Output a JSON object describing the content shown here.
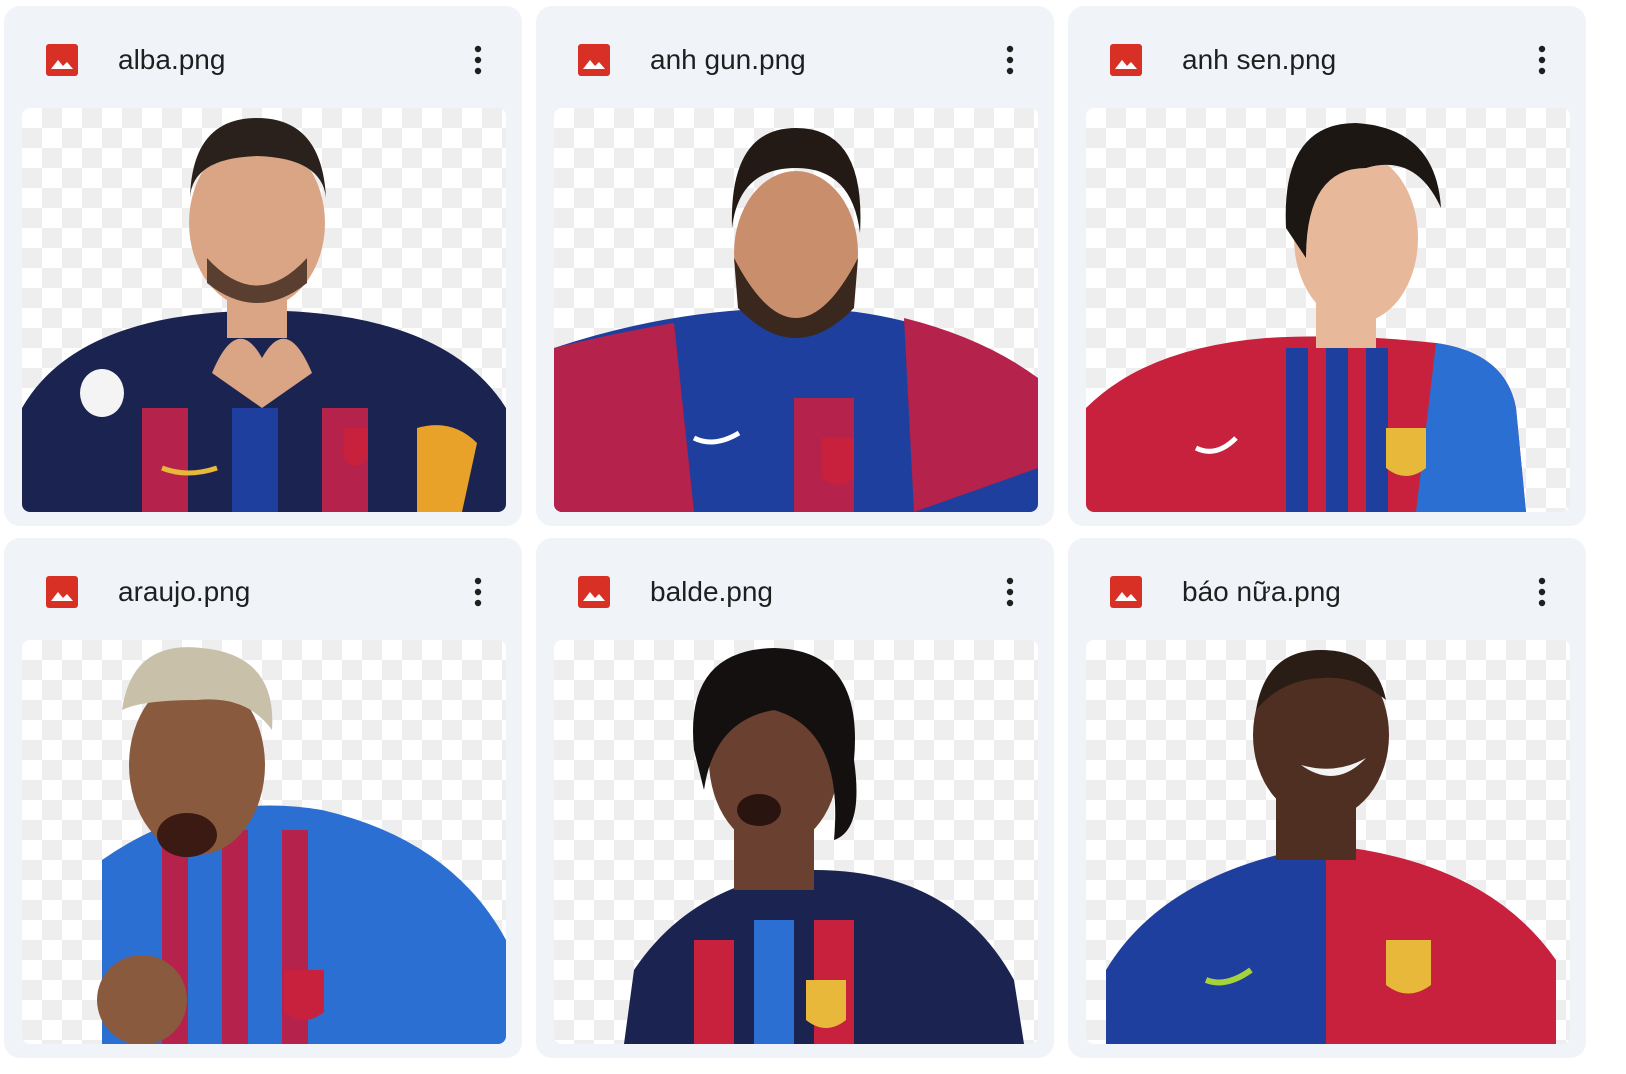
{
  "files": [
    {
      "name": "alba.png",
      "kind": "image-file-icon",
      "hair": "#2b211c",
      "skin": "#d9a584",
      "kit": "navy-stripe"
    },
    {
      "name": "anh gun.png",
      "kind": "image-file-icon",
      "hair": "#231a15",
      "skin": "#c98f6c",
      "kit": "blaugrana-classic"
    },
    {
      "name": "anh sen.png",
      "kind": "image-file-icon",
      "hair": "#1c1713",
      "skin": "#e7b89a",
      "kit": "blaugrana-red"
    },
    {
      "name": "araujo.png",
      "kind": "image-file-icon",
      "hair": "#c9c0aa",
      "skin": "#8a5a3e",
      "kit": "blaugrana-red"
    },
    {
      "name": "balde.png",
      "kind": "image-file-icon",
      "hair": "#141010",
      "skin": "#6a4030",
      "kit": "blaugrana-navy"
    },
    {
      "name": "báo nữa.png",
      "kind": "image-file-icon",
      "hair": "#2a1d16",
      "skin": "#4e2f22",
      "kit": "half-split"
    }
  ],
  "colors": {
    "card_bg": "#f0f4f9",
    "icon_red": "#d93025",
    "text": "#1f1f1f",
    "barca_blue": "#1f3f9e",
    "barca_red": "#b5224b",
    "barca_navy": "#1b2450"
  },
  "icons": {
    "file_type": "image-icon",
    "menu": "more-vert-icon"
  }
}
